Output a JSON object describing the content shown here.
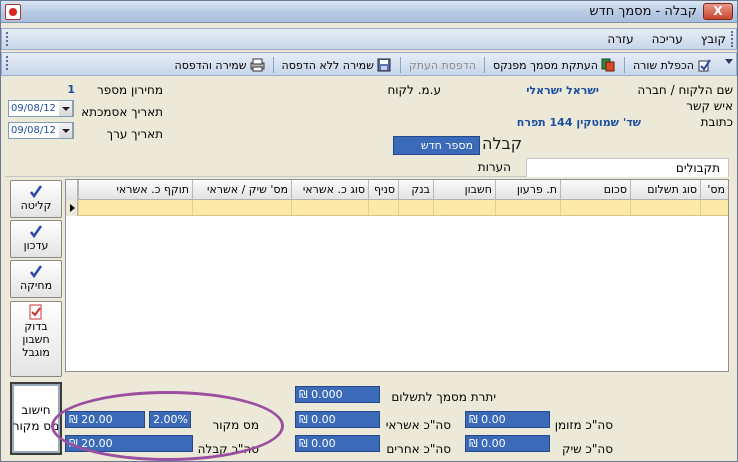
{
  "window": {
    "title": "קבלה - מסמך חדש",
    "close_label": "X"
  },
  "menu": {
    "items": [
      "קובץ",
      "עריכה",
      "עזרה"
    ]
  },
  "toolbar": {
    "buttons": [
      {
        "label": "הכפלת שורה",
        "icon": "duplicate-row-icon",
        "enabled": true
      },
      {
        "label": "העתקת מסמך מפנקס",
        "icon": "copy-document-icon",
        "enabled": true
      },
      {
        "label": "הדפסת העתק",
        "icon": "print-copy-icon",
        "enabled": false
      },
      {
        "label": "שמירה ללא הדפסה",
        "icon": "save-no-print-icon",
        "enabled": true
      },
      {
        "label": "שמירה והדפסה",
        "icon": "save-print-icon",
        "enabled": true
      }
    ]
  },
  "header": {
    "customer_label": "שם הלקוח / חברה",
    "customer_value": "ישראל ישראלי",
    "contact_label": "איש קשר",
    "address_label": "כתובת",
    "address_value": "שד' שמוטקין 144 תפרח",
    "vat_id_label": "ע.מ. לקוח",
    "price_list_label": "מחירון מספר",
    "price_list_value": "1",
    "doc_date_label": "תאריך אסמכתא",
    "doc_date_value": "09/08/12",
    "value_date_label": "תאריך ערך",
    "value_date_value": "09/08/12",
    "doc_type": "קבלה",
    "doc_number": "מספר חדש"
  },
  "tabs": [
    {
      "label": "תקבולים",
      "active": true
    },
    {
      "label": "הערות",
      "active": false
    }
  ],
  "grid": {
    "columns": [
      "מס'",
      "סוג תשלום",
      "סכום",
      "ת. פרעון",
      "חשבון",
      "בנק",
      "סניף",
      "סוג כ. אשראי",
      "מס' שיק / אשראי",
      "תוקף כ. אשראי"
    ]
  },
  "side_buttons": {
    "absorb": "קליטה",
    "update": "עדכון",
    "delete": "מחיקה",
    "check_account_1": "בדוק",
    "check_account_2": "חשבון",
    "check_account_3": "מוגבל",
    "calc_1": "חישוב",
    "calc_2": "מס מקור"
  },
  "summary": {
    "remaining_label": "יתרת מסמך לתשלום",
    "remaining_value": "0.000",
    "cash_label": "סה\"כ מזומן",
    "cash_value": "0.00",
    "credit_label": "סה\"כ אשראי",
    "credit_value": "0.00",
    "check_label": "סה\"כ שיק",
    "check_value": "0.00",
    "other_label": "סה\"כ אחרים",
    "other_value": "0.00",
    "withholding_label": "מס מקור",
    "withholding_pct": "2.00%",
    "withholding_value": "20.00",
    "total_label": "סה\"כ קבלה",
    "total_value": "20.00",
    "currency": "₪"
  },
  "colors": {
    "field_blue": "#3a6ab8",
    "highlight_row": "#fde9a8",
    "annotation": "#9b4fa0"
  }
}
